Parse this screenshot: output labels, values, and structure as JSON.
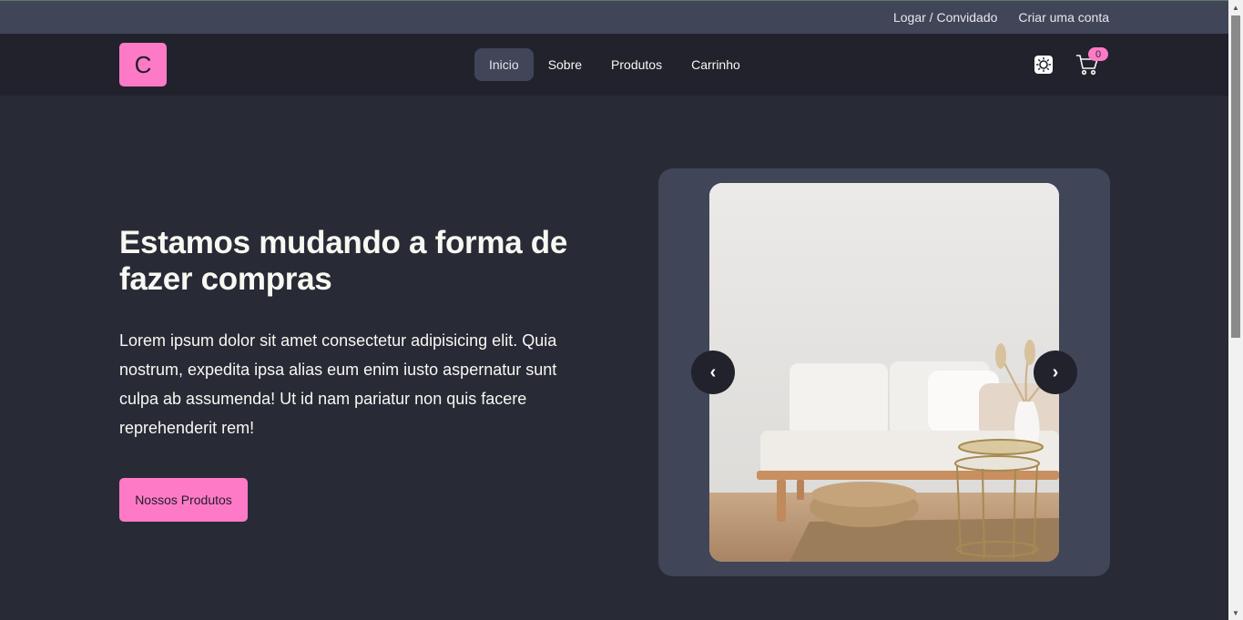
{
  "topbar": {
    "login_label": "Logar / Convidado",
    "signup_label": "Criar uma conta"
  },
  "navbar": {
    "logo_letter": "C",
    "items": [
      {
        "label": "Inicio",
        "active": true
      },
      {
        "label": "Sobre",
        "active": false
      },
      {
        "label": "Produtos",
        "active": false
      },
      {
        "label": "Carrinho",
        "active": false
      }
    ],
    "theme_icon": "sun-icon",
    "cart_icon": "cart-icon",
    "cart_count": "0"
  },
  "hero": {
    "title": "Estamos mudando a forma de fazer compras",
    "text": "Lorem ipsum dolor sit amet consectetur adipisicing elit. Quia nostrum, expedita ipsa alias eum enim iusto aspernatur sunt culpa ab assumenda! Ut id nam pariatur non quis facere reprehenderit rem!",
    "button_label": "Nossos Produtos"
  },
  "carousel": {
    "prev_label": "‹",
    "next_label": "›"
  },
  "colors": {
    "accent": "#ff7ac6",
    "background": "#282a36",
    "navbar": "#21222c",
    "topbar": "#414558"
  }
}
